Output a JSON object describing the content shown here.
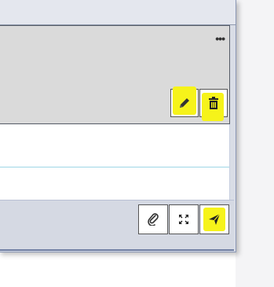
{
  "card": {
    "more_label": "•••",
    "actions": [
      {
        "name": "edit-button",
        "icon": "pencil-icon"
      },
      {
        "name": "delete-button",
        "icon": "trash-icon"
      }
    ]
  },
  "composer": {
    "actions": [
      {
        "name": "attach-button",
        "icon": "paperclip-icon"
      },
      {
        "name": "expand-button",
        "icon": "expand-icon"
      },
      {
        "name": "send-button",
        "icon": "send-icon"
      }
    ]
  },
  "colors": {
    "highlight": "#f6f31a",
    "panel": "#d9dde6",
    "card": "#dadada",
    "border_accent": "#8a97b5"
  }
}
